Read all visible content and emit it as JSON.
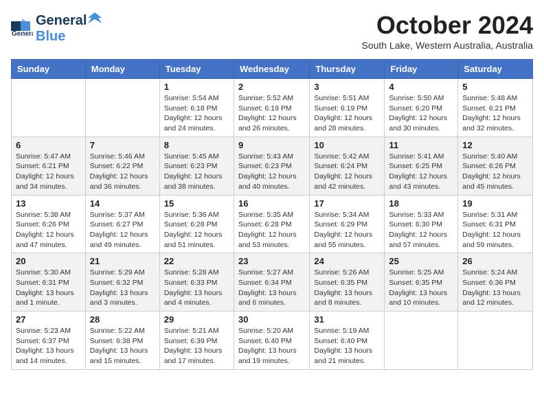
{
  "header": {
    "logo_general": "General",
    "logo_blue": "Blue",
    "month": "October 2024",
    "subtitle": "South Lake, Western Australia, Australia"
  },
  "days_of_week": [
    "Sunday",
    "Monday",
    "Tuesday",
    "Wednesday",
    "Thursday",
    "Friday",
    "Saturday"
  ],
  "weeks": [
    {
      "row_class": "week-row-1",
      "days": [
        {
          "number": "",
          "info": ""
        },
        {
          "number": "",
          "info": ""
        },
        {
          "number": "1",
          "info": "Sunrise: 5:54 AM\nSunset: 6:18 PM\nDaylight: 12 hours and 24 minutes."
        },
        {
          "number": "2",
          "info": "Sunrise: 5:52 AM\nSunset: 6:19 PM\nDaylight: 12 hours and 26 minutes."
        },
        {
          "number": "3",
          "info": "Sunrise: 5:51 AM\nSunset: 6:19 PM\nDaylight: 12 hours and 28 minutes."
        },
        {
          "number": "4",
          "info": "Sunrise: 5:50 AM\nSunset: 6:20 PM\nDaylight: 12 hours and 30 minutes."
        },
        {
          "number": "5",
          "info": "Sunrise: 5:48 AM\nSunset: 6:21 PM\nDaylight: 12 hours and 32 minutes."
        }
      ]
    },
    {
      "row_class": "week-row-2",
      "days": [
        {
          "number": "6",
          "info": "Sunrise: 5:47 AM\nSunset: 6:21 PM\nDaylight: 12 hours and 34 minutes."
        },
        {
          "number": "7",
          "info": "Sunrise: 5:46 AM\nSunset: 6:22 PM\nDaylight: 12 hours and 36 minutes."
        },
        {
          "number": "8",
          "info": "Sunrise: 5:45 AM\nSunset: 6:23 PM\nDaylight: 12 hours and 38 minutes."
        },
        {
          "number": "9",
          "info": "Sunrise: 5:43 AM\nSunset: 6:23 PM\nDaylight: 12 hours and 40 minutes."
        },
        {
          "number": "10",
          "info": "Sunrise: 5:42 AM\nSunset: 6:24 PM\nDaylight: 12 hours and 42 minutes."
        },
        {
          "number": "11",
          "info": "Sunrise: 5:41 AM\nSunset: 6:25 PM\nDaylight: 12 hours and 43 minutes."
        },
        {
          "number": "12",
          "info": "Sunrise: 5:40 AM\nSunset: 6:26 PM\nDaylight: 12 hours and 45 minutes."
        }
      ]
    },
    {
      "row_class": "week-row-3",
      "days": [
        {
          "number": "13",
          "info": "Sunrise: 5:38 AM\nSunset: 6:26 PM\nDaylight: 12 hours and 47 minutes."
        },
        {
          "number": "14",
          "info": "Sunrise: 5:37 AM\nSunset: 6:27 PM\nDaylight: 12 hours and 49 minutes."
        },
        {
          "number": "15",
          "info": "Sunrise: 5:36 AM\nSunset: 6:28 PM\nDaylight: 12 hours and 51 minutes."
        },
        {
          "number": "16",
          "info": "Sunrise: 5:35 AM\nSunset: 6:28 PM\nDaylight: 12 hours and 53 minutes."
        },
        {
          "number": "17",
          "info": "Sunrise: 5:34 AM\nSunset: 6:29 PM\nDaylight: 12 hours and 55 minutes."
        },
        {
          "number": "18",
          "info": "Sunrise: 5:33 AM\nSunset: 6:30 PM\nDaylight: 12 hours and 57 minutes."
        },
        {
          "number": "19",
          "info": "Sunrise: 5:31 AM\nSunset: 6:31 PM\nDaylight: 12 hours and 59 minutes."
        }
      ]
    },
    {
      "row_class": "week-row-4",
      "days": [
        {
          "number": "20",
          "info": "Sunrise: 5:30 AM\nSunset: 6:31 PM\nDaylight: 13 hours and 1 minute."
        },
        {
          "number": "21",
          "info": "Sunrise: 5:29 AM\nSunset: 6:32 PM\nDaylight: 13 hours and 3 minutes."
        },
        {
          "number": "22",
          "info": "Sunrise: 5:28 AM\nSunset: 6:33 PM\nDaylight: 13 hours and 4 minutes."
        },
        {
          "number": "23",
          "info": "Sunrise: 5:27 AM\nSunset: 6:34 PM\nDaylight: 13 hours and 6 minutes."
        },
        {
          "number": "24",
          "info": "Sunrise: 5:26 AM\nSunset: 6:35 PM\nDaylight: 13 hours and 8 minutes."
        },
        {
          "number": "25",
          "info": "Sunrise: 5:25 AM\nSunset: 6:35 PM\nDaylight: 13 hours and 10 minutes."
        },
        {
          "number": "26",
          "info": "Sunrise: 5:24 AM\nSunset: 6:36 PM\nDaylight: 13 hours and 12 minutes."
        }
      ]
    },
    {
      "row_class": "week-row-5",
      "days": [
        {
          "number": "27",
          "info": "Sunrise: 5:23 AM\nSunset: 6:37 PM\nDaylight: 13 hours and 14 minutes."
        },
        {
          "number": "28",
          "info": "Sunrise: 5:22 AM\nSunset: 6:38 PM\nDaylight: 13 hours and 15 minutes."
        },
        {
          "number": "29",
          "info": "Sunrise: 5:21 AM\nSunset: 6:39 PM\nDaylight: 13 hours and 17 minutes."
        },
        {
          "number": "30",
          "info": "Sunrise: 5:20 AM\nSunset: 6:40 PM\nDaylight: 13 hours and 19 minutes."
        },
        {
          "number": "31",
          "info": "Sunrise: 5:19 AM\nSunset: 6:40 PM\nDaylight: 13 hours and 21 minutes."
        },
        {
          "number": "",
          "info": ""
        },
        {
          "number": "",
          "info": ""
        }
      ]
    }
  ]
}
